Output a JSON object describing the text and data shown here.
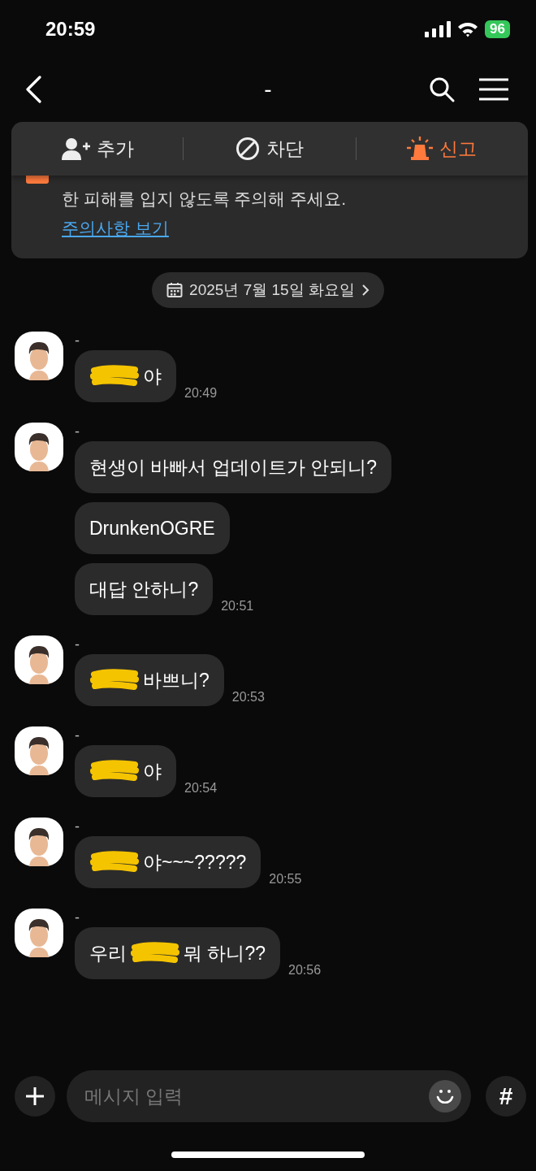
{
  "status_bar": {
    "time": "20:59",
    "battery": "96"
  },
  "header": {
    "title": "-"
  },
  "actions": [
    {
      "label": "추가",
      "kind": "add"
    },
    {
      "label": "차단",
      "kind": "block"
    },
    {
      "label": "신고",
      "kind": "report"
    }
  ],
  "notice": {
    "text": "한 피해를 입지 않도록 주의해 주세요.",
    "link": "주의사항 보기"
  },
  "date": "2025년 7월 15일 화요일",
  "groups": [
    {
      "sender": "-",
      "messages": [
        {
          "parts": [
            {
              "kind": "redacted"
            },
            {
              "kind": "text",
              "text": "야"
            }
          ],
          "time": "20:49"
        }
      ]
    },
    {
      "sender": "-",
      "messages": [
        {
          "parts": [
            {
              "kind": "text",
              "text": "현생이 바빠서 업데이트가 안되니?"
            }
          ]
        },
        {
          "parts": [
            {
              "kind": "text",
              "text": "DrunkenOGRE"
            }
          ]
        },
        {
          "parts": [
            {
              "kind": "text",
              "text": "대답 안하니?"
            }
          ],
          "time": "20:51"
        }
      ]
    },
    {
      "sender": "-",
      "messages": [
        {
          "parts": [
            {
              "kind": "redacted"
            },
            {
              "kind": "text",
              "text": "바쁘니?"
            }
          ],
          "time": "20:53"
        }
      ]
    },
    {
      "sender": "-",
      "messages": [
        {
          "parts": [
            {
              "kind": "redacted"
            },
            {
              "kind": "text",
              "text": "야"
            }
          ],
          "time": "20:54"
        }
      ]
    },
    {
      "sender": "-",
      "messages": [
        {
          "parts": [
            {
              "kind": "redacted"
            },
            {
              "kind": "text",
              "text": "야~~~?????"
            }
          ],
          "time": "20:55"
        }
      ]
    },
    {
      "sender": "-",
      "messages": [
        {
          "parts": [
            {
              "kind": "text",
              "text": "우리"
            },
            {
              "kind": "redacted"
            },
            {
              "kind": "text",
              "text": "뭐 하니??"
            }
          ],
          "time": "20:56"
        }
      ]
    }
  ],
  "composer": {
    "placeholder": "메시지 입력",
    "hash": "#"
  }
}
